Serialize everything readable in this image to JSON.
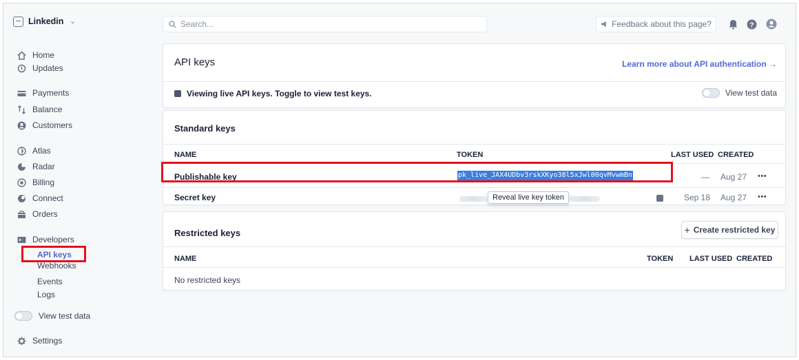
{
  "account": {
    "name": "Linkedin"
  },
  "nav": {
    "home": "Home",
    "updates": "Updates",
    "payments": "Payments",
    "balance": "Balance",
    "customers": "Customers",
    "atlas": "Atlas",
    "radar": "Radar",
    "billing": "Billing",
    "connect": "Connect",
    "orders": "Orders",
    "developers": "Developers",
    "dev_items": [
      "API keys",
      "Webhooks",
      "Events",
      "Logs"
    ],
    "view_test_data": "View test data",
    "settings": "Settings"
  },
  "topbar": {
    "search_placeholder": "Search...",
    "feedback": "Feedback about this page?"
  },
  "api_keys_card": {
    "title": "API keys",
    "learn_more": "Learn more about API authentication →",
    "notice": "Viewing live API keys. Toggle to view test keys.",
    "view_test_data": "View test data"
  },
  "standard_keys": {
    "title": "Standard keys",
    "columns": {
      "name": "NAME",
      "token": "TOKEN",
      "last_used": "LAST USED",
      "created": "CREATED"
    },
    "rows": [
      {
        "name": "Publishable key",
        "token": "pk_live_JAX4UDbv3rskXKyo38l5xJwl00qvMvwmBn",
        "last_used": "—",
        "created": "Aug 27",
        "more": "•••"
      },
      {
        "name": "Secret key",
        "token_action": "Reveal live key token",
        "last_used": "Sep 18",
        "created": "Aug 27",
        "more": "•••"
      }
    ]
  },
  "restricted_keys": {
    "title": "Restricted keys",
    "create_button": "Create restricted key",
    "columns": {
      "name": "NAME",
      "token": "TOKEN",
      "last_used": "LAST USED",
      "created": "CREATED"
    },
    "empty": "No restricted keys"
  },
  "colors": {
    "accent": "#5469d4",
    "highlight_box": "#e5101d",
    "selection": "#3b7ddd"
  }
}
